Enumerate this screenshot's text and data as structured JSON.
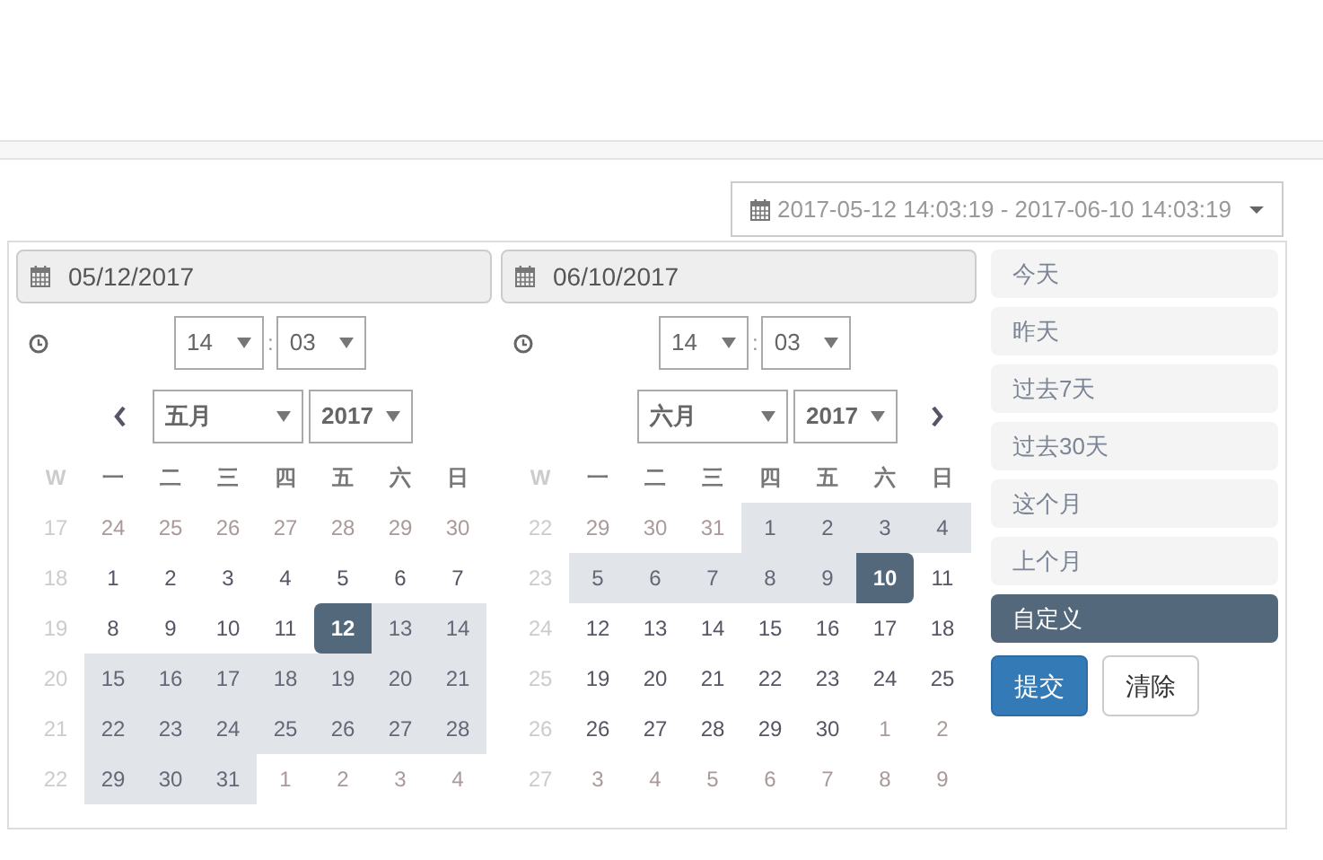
{
  "range_button": {
    "label": "2017-05-12 14:03:19 - 2017-06-10 14:03:19"
  },
  "calendars": [
    {
      "kind": "start",
      "date_input": "05/12/2017",
      "hour": "14",
      "time_separator": ":",
      "minute": "03",
      "month": "五月",
      "year": "2017",
      "weekdays": [
        "W",
        "一",
        "二",
        "三",
        "四",
        "五",
        "六",
        "日"
      ],
      "rows": [
        {
          "week": "17",
          "days": [
            {
              "label": "24",
              "outside": true,
              "in_range": false,
              "selected": false
            },
            {
              "label": "25",
              "outside": true,
              "in_range": false,
              "selected": false
            },
            {
              "label": "26",
              "outside": true,
              "in_range": false,
              "selected": false
            },
            {
              "label": "27",
              "outside": true,
              "in_range": false,
              "selected": false
            },
            {
              "label": "28",
              "outside": true,
              "in_range": false,
              "selected": false
            },
            {
              "label": "29",
              "outside": true,
              "in_range": false,
              "selected": false
            },
            {
              "label": "30",
              "outside": true,
              "in_range": false,
              "selected": false
            }
          ]
        },
        {
          "week": "18",
          "days": [
            {
              "label": "1",
              "outside": false,
              "in_range": false,
              "selected": false
            },
            {
              "label": "2",
              "outside": false,
              "in_range": false,
              "selected": false
            },
            {
              "label": "3",
              "outside": false,
              "in_range": false,
              "selected": false
            },
            {
              "label": "4",
              "outside": false,
              "in_range": false,
              "selected": false
            },
            {
              "label": "5",
              "outside": false,
              "in_range": false,
              "selected": false
            },
            {
              "label": "6",
              "outside": false,
              "in_range": false,
              "selected": false
            },
            {
              "label": "7",
              "outside": false,
              "in_range": false,
              "selected": false
            }
          ]
        },
        {
          "week": "19",
          "days": [
            {
              "label": "8",
              "outside": false,
              "in_range": false,
              "selected": false
            },
            {
              "label": "9",
              "outside": false,
              "in_range": false,
              "selected": false
            },
            {
              "label": "10",
              "outside": false,
              "in_range": false,
              "selected": false
            },
            {
              "label": "11",
              "outside": false,
              "in_range": false,
              "selected": false
            },
            {
              "label": "12",
              "outside": false,
              "in_range": true,
              "selected": true
            },
            {
              "label": "13",
              "outside": false,
              "in_range": true,
              "selected": false
            },
            {
              "label": "14",
              "outside": false,
              "in_range": true,
              "selected": false
            }
          ]
        },
        {
          "week": "20",
          "days": [
            {
              "label": "15",
              "outside": false,
              "in_range": true,
              "selected": false
            },
            {
              "label": "16",
              "outside": false,
              "in_range": true,
              "selected": false
            },
            {
              "label": "17",
              "outside": false,
              "in_range": true,
              "selected": false
            },
            {
              "label": "18",
              "outside": false,
              "in_range": true,
              "selected": false
            },
            {
              "label": "19",
              "outside": false,
              "in_range": true,
              "selected": false
            },
            {
              "label": "20",
              "outside": false,
              "in_range": true,
              "selected": false
            },
            {
              "label": "21",
              "outside": false,
              "in_range": true,
              "selected": false
            }
          ]
        },
        {
          "week": "21",
          "days": [
            {
              "label": "22",
              "outside": false,
              "in_range": true,
              "selected": false
            },
            {
              "label": "23",
              "outside": false,
              "in_range": true,
              "selected": false
            },
            {
              "label": "24",
              "outside": false,
              "in_range": true,
              "selected": false
            },
            {
              "label": "25",
              "outside": false,
              "in_range": true,
              "selected": false
            },
            {
              "label": "26",
              "outside": false,
              "in_range": true,
              "selected": false
            },
            {
              "label": "27",
              "outside": false,
              "in_range": true,
              "selected": false
            },
            {
              "label": "28",
              "outside": false,
              "in_range": true,
              "selected": false
            }
          ]
        },
        {
          "week": "22",
          "days": [
            {
              "label": "29",
              "outside": false,
              "in_range": true,
              "selected": false
            },
            {
              "label": "30",
              "outside": false,
              "in_range": true,
              "selected": false
            },
            {
              "label": "31",
              "outside": false,
              "in_range": true,
              "selected": false
            },
            {
              "label": "1",
              "outside": true,
              "in_range": false,
              "selected": false
            },
            {
              "label": "2",
              "outside": true,
              "in_range": false,
              "selected": false
            },
            {
              "label": "3",
              "outside": true,
              "in_range": false,
              "selected": false
            },
            {
              "label": "4",
              "outside": true,
              "in_range": false,
              "selected": false
            }
          ]
        }
      ]
    },
    {
      "kind": "end",
      "date_input": "06/10/2017",
      "hour": "14",
      "time_separator": ":",
      "minute": "03",
      "month": "六月",
      "year": "2017",
      "weekdays": [
        "W",
        "一",
        "二",
        "三",
        "四",
        "五",
        "六",
        "日"
      ],
      "rows": [
        {
          "week": "22",
          "days": [
            {
              "label": "29",
              "outside": true,
              "in_range": false,
              "selected": false
            },
            {
              "label": "30",
              "outside": true,
              "in_range": false,
              "selected": false
            },
            {
              "label": "31",
              "outside": true,
              "in_range": false,
              "selected": false
            },
            {
              "label": "1",
              "outside": false,
              "in_range": true,
              "selected": false
            },
            {
              "label": "2",
              "outside": false,
              "in_range": true,
              "selected": false
            },
            {
              "label": "3",
              "outside": false,
              "in_range": true,
              "selected": false
            },
            {
              "label": "4",
              "outside": false,
              "in_range": true,
              "selected": false
            }
          ]
        },
        {
          "week": "23",
          "days": [
            {
              "label": "5",
              "outside": false,
              "in_range": true,
              "selected": false
            },
            {
              "label": "6",
              "outside": false,
              "in_range": true,
              "selected": false
            },
            {
              "label": "7",
              "outside": false,
              "in_range": true,
              "selected": false
            },
            {
              "label": "8",
              "outside": false,
              "in_range": true,
              "selected": false
            },
            {
              "label": "9",
              "outside": false,
              "in_range": true,
              "selected": false
            },
            {
              "label": "10",
              "outside": false,
              "in_range": true,
              "selected": true
            },
            {
              "label": "11",
              "outside": false,
              "in_range": false,
              "selected": false
            }
          ]
        },
        {
          "week": "24",
          "days": [
            {
              "label": "12",
              "outside": false,
              "in_range": false,
              "selected": false
            },
            {
              "label": "13",
              "outside": false,
              "in_range": false,
              "selected": false
            },
            {
              "label": "14",
              "outside": false,
              "in_range": false,
              "selected": false
            },
            {
              "label": "15",
              "outside": false,
              "in_range": false,
              "selected": false
            },
            {
              "label": "16",
              "outside": false,
              "in_range": false,
              "selected": false
            },
            {
              "label": "17",
              "outside": false,
              "in_range": false,
              "selected": false
            },
            {
              "label": "18",
              "outside": false,
              "in_range": false,
              "selected": false
            }
          ]
        },
        {
          "week": "25",
          "days": [
            {
              "label": "19",
              "outside": false,
              "in_range": false,
              "selected": false
            },
            {
              "label": "20",
              "outside": false,
              "in_range": false,
              "selected": false
            },
            {
              "label": "21",
              "outside": false,
              "in_range": false,
              "selected": false
            },
            {
              "label": "22",
              "outside": false,
              "in_range": false,
              "selected": false
            },
            {
              "label": "23",
              "outside": false,
              "in_range": false,
              "selected": false
            },
            {
              "label": "24",
              "outside": false,
              "in_range": false,
              "selected": false
            },
            {
              "label": "25",
              "outside": false,
              "in_range": false,
              "selected": false
            }
          ]
        },
        {
          "week": "26",
          "days": [
            {
              "label": "26",
              "outside": false,
              "in_range": false,
              "selected": false
            },
            {
              "label": "27",
              "outside": false,
              "in_range": false,
              "selected": false
            },
            {
              "label": "28",
              "outside": false,
              "in_range": false,
              "selected": false
            },
            {
              "label": "29",
              "outside": false,
              "in_range": false,
              "selected": false
            },
            {
              "label": "30",
              "outside": false,
              "in_range": false,
              "selected": false
            },
            {
              "label": "1",
              "outside": true,
              "in_range": false,
              "selected": false
            },
            {
              "label": "2",
              "outside": true,
              "in_range": false,
              "selected": false
            }
          ]
        },
        {
          "week": "27",
          "days": [
            {
              "label": "3",
              "outside": true,
              "in_range": false,
              "selected": false
            },
            {
              "label": "4",
              "outside": true,
              "in_range": false,
              "selected": false
            },
            {
              "label": "5",
              "outside": true,
              "in_range": false,
              "selected": false
            },
            {
              "label": "6",
              "outside": true,
              "in_range": false,
              "selected": false
            },
            {
              "label": "7",
              "outside": true,
              "in_range": false,
              "selected": false
            },
            {
              "label": "8",
              "outside": true,
              "in_range": false,
              "selected": false
            },
            {
              "label": "9",
              "outside": true,
              "in_range": false,
              "selected": false
            }
          ]
        }
      ]
    }
  ],
  "ranges": [
    {
      "label": "今天",
      "selected": false
    },
    {
      "label": "昨天",
      "selected": false
    },
    {
      "label": "过去7天",
      "selected": false
    },
    {
      "label": "过去30天",
      "selected": false
    },
    {
      "label": "这个月",
      "selected": false
    },
    {
      "label": "上个月",
      "selected": false
    },
    {
      "label": "自定义",
      "selected": true
    }
  ],
  "buttons": [
    {
      "label": "提交",
      "kind": "primary"
    },
    {
      "label": "清除",
      "kind": "default"
    }
  ]
}
